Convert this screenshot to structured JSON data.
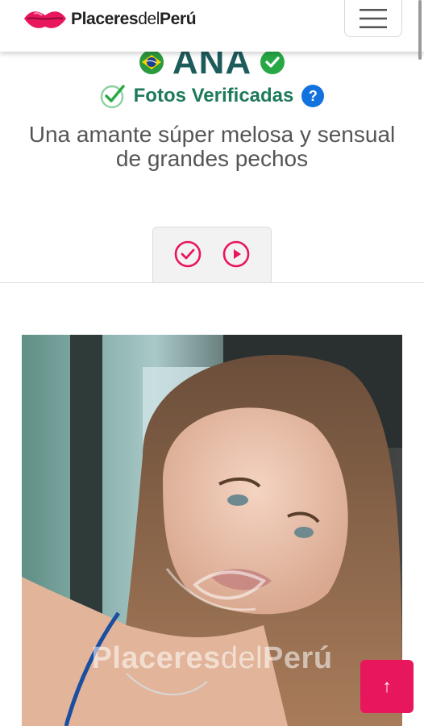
{
  "header": {
    "logo_bold": "Placeres",
    "logo_light": "del",
    "logo_bold2": "Perú",
    "menu_icon": "hamburger-icon"
  },
  "profile": {
    "name": "ANA",
    "flag": "brazil-flag",
    "verified_label": "Fotos Verificadas",
    "help_label": "?",
    "tagline": "Una amante súper melosa y sensual de grandes pechos"
  },
  "tabs": [
    {
      "icon": "check-circle-icon"
    },
    {
      "icon": "play-circle-icon"
    }
  ],
  "photo": {
    "watermark_bold": "Placeres",
    "watermark_light": "del",
    "watermark_bold2": "Perú"
  },
  "scroll_top": {
    "label": "↑"
  },
  "colors": {
    "brand_pink": "#e8175d",
    "name_teal": "#1e5c5c",
    "verified_green": "#1f7a5c",
    "help_blue": "#1273de",
    "check_green": "#27a844"
  }
}
